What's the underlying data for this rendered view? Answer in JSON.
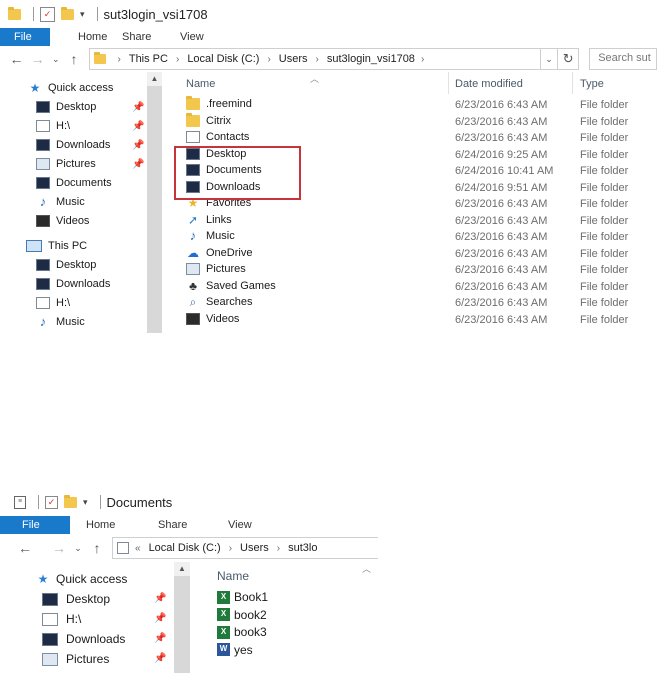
{
  "win1": {
    "title": "sut3login_vsi1708",
    "ribbon_tabs": [
      "File",
      "Home",
      "Share",
      "View"
    ],
    "address": {
      "crumbs": [
        "This PC",
        "Local Disk (C:)",
        "Users",
        "sut3login_vsi1708"
      ],
      "search_placeholder": "Search sut"
    },
    "nav": {
      "quick_access": "Quick access",
      "qa_items": [
        "Desktop",
        "H:\\",
        "Downloads",
        "Pictures",
        "Documents",
        "Music",
        "Videos"
      ],
      "this_pc": "This PC",
      "pc_items": [
        "Desktop",
        "Downloads",
        "H:\\",
        "Music"
      ]
    },
    "columns": {
      "name": "Name",
      "date": "Date modified",
      "type": "Type"
    },
    "rows": [
      {
        "name": ".freemind",
        "date": "6/23/2016 6:43 AM",
        "type": "File folder",
        "icon": "folder-icon"
      },
      {
        "name": "Citrix",
        "date": "6/23/2016 6:43 AM",
        "type": "File folder",
        "icon": "folder-icon"
      },
      {
        "name": "Contacts",
        "date": "6/23/2016 6:43 AM",
        "type": "File folder",
        "icon": "contacts-icon"
      },
      {
        "name": "Desktop",
        "date": "6/24/2016 9:25 AM",
        "type": "File folder",
        "icon": "desktop-icon"
      },
      {
        "name": "Documents",
        "date": "6/24/2016 10:41 AM",
        "type": "File folder",
        "icon": "documents-icon"
      },
      {
        "name": "Downloads",
        "date": "6/24/2016 9:51 AM",
        "type": "File folder",
        "icon": "downloads-icon"
      },
      {
        "name": "Favorites",
        "date": "6/23/2016 6:43 AM",
        "type": "File folder",
        "icon": "favorites-icon"
      },
      {
        "name": "Links",
        "date": "6/23/2016 6:43 AM",
        "type": "File folder",
        "icon": "links-icon"
      },
      {
        "name": "Music",
        "date": "6/23/2016 6:43 AM",
        "type": "File folder",
        "icon": "music-icon"
      },
      {
        "name": "OneDrive",
        "date": "6/23/2016 6:43 AM",
        "type": "File folder",
        "icon": "onedrive-icon"
      },
      {
        "name": "Pictures",
        "date": "6/23/2016 6:43 AM",
        "type": "File folder",
        "icon": "pictures-icon"
      },
      {
        "name": "Saved Games",
        "date": "6/23/2016 6:43 AM",
        "type": "File folder",
        "icon": "saved-games-icon"
      },
      {
        "name": "Searches",
        "date": "6/23/2016 6:43 AM",
        "type": "File folder",
        "icon": "searches-icon"
      },
      {
        "name": "Videos",
        "date": "6/23/2016 6:43 AM",
        "type": "File folder",
        "icon": "videos-icon"
      }
    ]
  },
  "win2": {
    "title": "Documents",
    "ribbon_tabs": [
      "File",
      "Home",
      "Share",
      "View"
    ],
    "address": {
      "crumbs": [
        "Local Disk (C:)",
        "Users",
        "sut3lo"
      ]
    },
    "nav": {
      "quick_access": "Quick access",
      "qa_items": [
        "Desktop",
        "H:\\",
        "Downloads",
        "Pictures"
      ]
    },
    "columns": {
      "name": "Name"
    },
    "rows": [
      {
        "name": "Book1",
        "icon": "excel-icon"
      },
      {
        "name": "book2",
        "icon": "excel-icon"
      },
      {
        "name": "book3",
        "icon": "excel-icon"
      },
      {
        "name": "yes",
        "icon": "word-icon"
      }
    ]
  },
  "colors": {
    "accent": "#1979ca",
    "highlight": "#c8323a",
    "folder": "#f3c64d"
  }
}
